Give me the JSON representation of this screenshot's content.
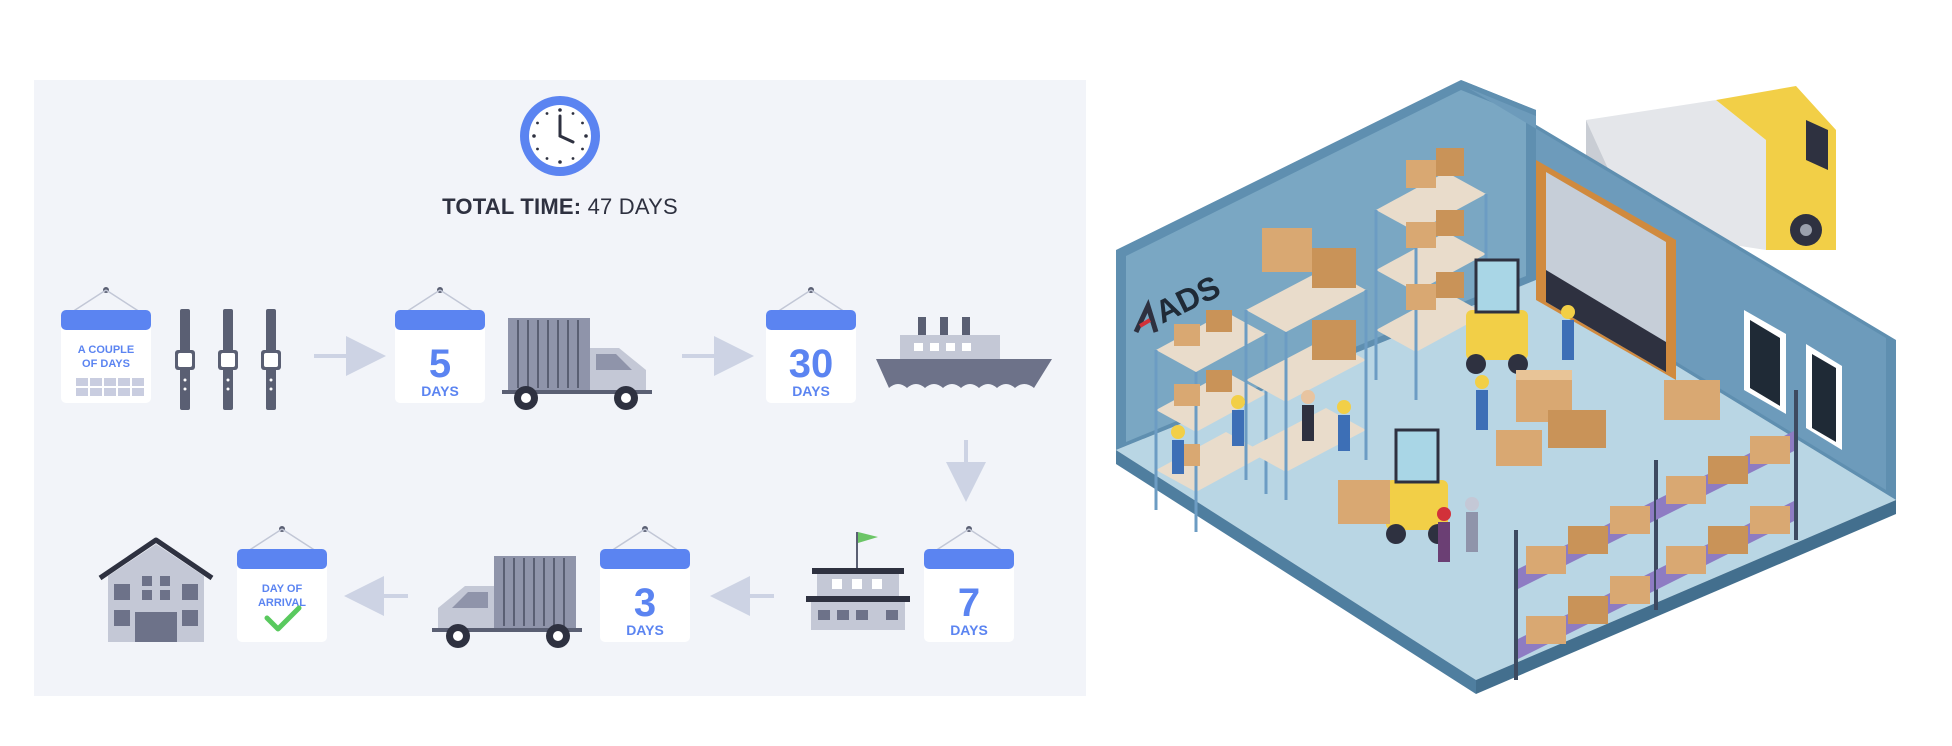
{
  "timeline": {
    "total_label": "TOTAL TIME:",
    "total_value": "47 DAYS",
    "steps": [
      {
        "line1": "A COUPLE",
        "line2": "OF DAYS",
        "icon": "watches-icon"
      },
      {
        "number": "5",
        "unit": "DAYS",
        "icon": "truck-icon"
      },
      {
        "number": "30",
        "unit": "DAYS",
        "icon": "ship-icon"
      },
      {
        "number": "7",
        "unit": "DAYS",
        "icon": "customs-building-icon"
      },
      {
        "number": "3",
        "unit": "DAYS",
        "icon": "truck-icon"
      },
      {
        "line1": "DAY OF",
        "line2": "ARRIVAL",
        "icon": "house-icon"
      }
    ]
  },
  "warehouse": {
    "logo_text": "ADS"
  },
  "colors": {
    "accent": "#5b84f1",
    "icon_gray": "#8f94aa",
    "panel_bg": "#f2f4f9",
    "check": "#59c95e",
    "wall": "#5f8fb0",
    "floor": "#b9d6e4"
  }
}
